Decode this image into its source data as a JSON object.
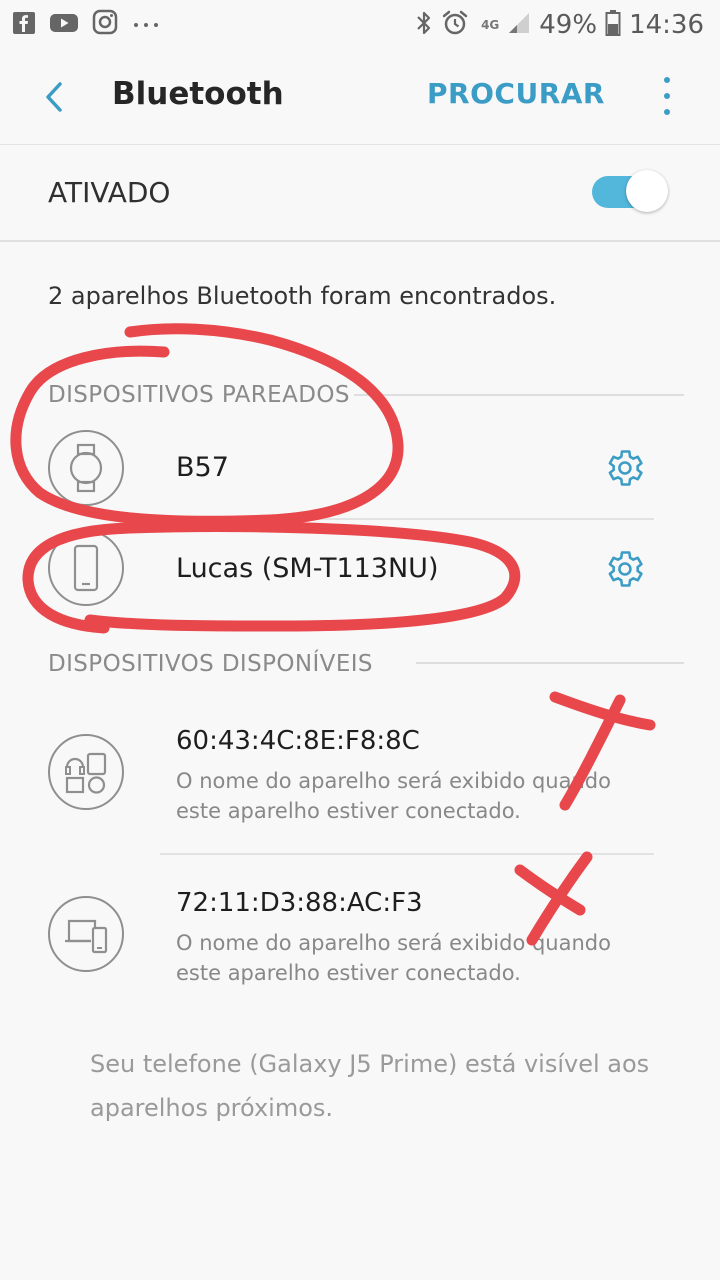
{
  "status_bar": {
    "left_icons": [
      "facebook-icon",
      "youtube-icon",
      "instagram-icon",
      "more-notifications-icon"
    ],
    "signal_type": "4G",
    "battery": "49%",
    "time": "14:36"
  },
  "app_bar": {
    "title": "Bluetooth",
    "action_label": "PROCURAR"
  },
  "bluetooth": {
    "label": "ATIVADO",
    "enabled": true
  },
  "found_text": "2 aparelhos Bluetooth foram encontrados.",
  "paired": {
    "header": "DISPOSITIVOS PAREADOS",
    "devices": [
      {
        "name": "B57",
        "icon": "smartwatch-icon"
      },
      {
        "name": "Lucas (SM-T113NU)",
        "icon": "phone-icon"
      }
    ]
  },
  "available": {
    "header": "DISPOSITIVOS DISPONÍVEIS",
    "devices": [
      {
        "name": "60:43:4C:8E:F8:8C",
        "description": "O nome do aparelho será exibido quando este aparelho estiver conectado.",
        "icon": "multi-device-icon"
      },
      {
        "name": "72:11:D3:88:AC:F3",
        "description": "O nome do aparelho será exibido quando este aparelho estiver conectado.",
        "icon": "tablet-phone-icon"
      }
    ]
  },
  "visibility_text": "Seu telefone (Galaxy J5 Prime) está visível aos aparelhos próximos.",
  "colors": {
    "accent": "#3b9cc5",
    "toggle": "#53b6db",
    "annotation": "#e8474c"
  }
}
